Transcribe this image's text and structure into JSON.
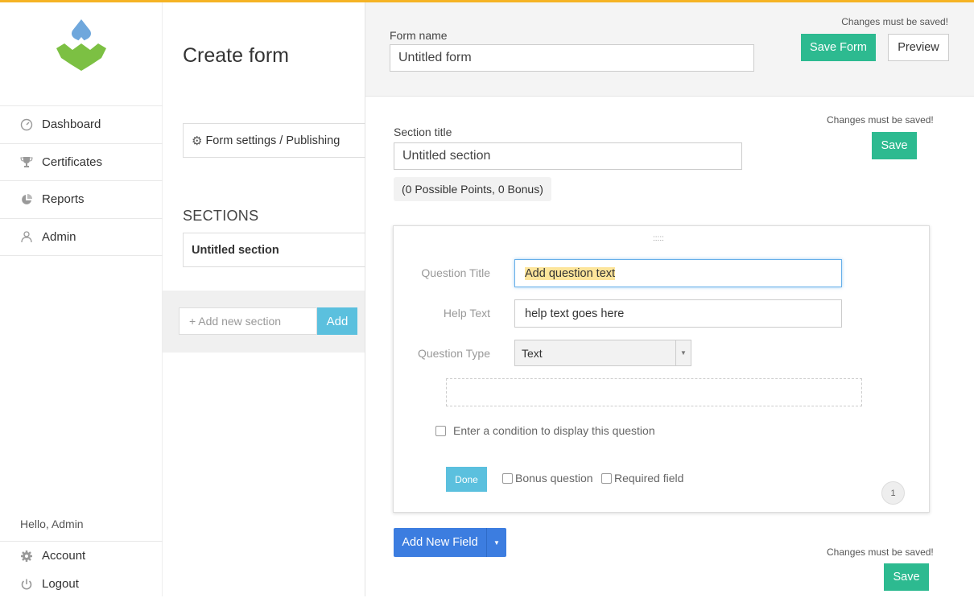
{
  "brand": {
    "accent": "#f5b324",
    "primary_green": "#2dba90",
    "info_blue": "#5bc0de",
    "action_blue": "#3c7de0"
  },
  "nav": {
    "items": [
      {
        "label": "Dashboard",
        "icon": "dashboard-icon"
      },
      {
        "label": "Certificates",
        "icon": "trophy-icon"
      },
      {
        "label": "Reports",
        "icon": "pie-chart-icon"
      },
      {
        "label": "Admin",
        "icon": "users-icon"
      }
    ],
    "greeting": "Hello, Admin",
    "account_label": "Account",
    "logout_label": "Logout"
  },
  "middle": {
    "page_title": "Create form",
    "form_settings_label": "Form settings / Publishing",
    "sections_header": "SECTIONS",
    "sections": [
      "Untitled section"
    ],
    "add_section_placeholder": "+ Add new section",
    "add_button_label": "Add"
  },
  "header": {
    "form_name_label": "Form name",
    "form_name_value": "Untitled form",
    "changes_note": "Changes must be saved!",
    "save_form_label": "Save Form",
    "preview_label": "Preview"
  },
  "section": {
    "title_label": "Section title",
    "title_value": "Untitled section",
    "changes_note": "Changes must be saved!",
    "save_label": "Save",
    "points": "(0 Possible Points, 0 Bonus)"
  },
  "question": {
    "drag_handle": ":::::",
    "title_label": "Question Title",
    "title_value": "Add question text",
    "help_label": "Help Text",
    "help_value": "help text goes here",
    "type_label": "Question Type",
    "type_value": "Text",
    "condition_label": "Enter a condition to display this question",
    "done_label": "Done",
    "bonus_label": "Bonus question",
    "required_label": "Required field",
    "number": "1"
  },
  "footer": {
    "add_field_label": "Add New Field",
    "changes_note": "Changes must be saved!",
    "save_label": "Save"
  }
}
